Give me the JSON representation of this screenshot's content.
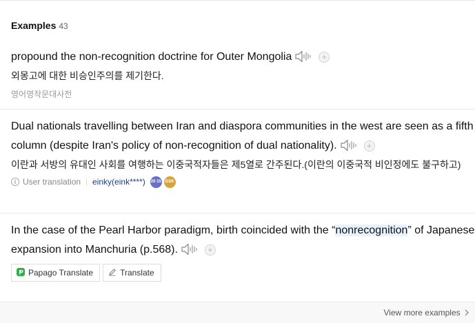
{
  "section": {
    "title": "Examples",
    "count": "43"
  },
  "examples": [
    {
      "english": "propound the non-recognition doctrine for Outer Mongolia",
      "korean": "외몽고에 대한 비승인주의를 제기한다.",
      "source": "영어영작문대사전"
    },
    {
      "english": "Dual nationals travelling between Iran and diaspora communities in the west are seen as a fifth column (despite Iran's policy of non-recognition of dual nationality).",
      "korean": "이란과 서방의 유대인 사회를 여행하는 이중국적자들은 제5열로 간주된다.(이란의 이중국적 비인정에도 불구하고)",
      "meta": {
        "user_translation": "User translation",
        "username": "einky(eink****)",
        "badge1": "20 15",
        "badge2": "DSK"
      }
    },
    {
      "english_before": "In the case of the Pearl Harbor paradigm, birth coincided with the “",
      "highlight": "nonrecognition",
      "english_after": "” of Japanese expansion into Manchuria (p.568)."
    }
  ],
  "buttons": {
    "papago": "Papago Translate",
    "translate": "Translate"
  },
  "footer": {
    "view_more": "View more examples"
  },
  "icons": {
    "speaker": "speaker-icon",
    "add": "plus-icon",
    "papago": "papago-icon",
    "translate": "pencil-icon",
    "info": "info-icon",
    "chevron": "chevron-right-icon"
  },
  "colors": {
    "highlight": "#e7f2fd",
    "user_link": "#1a3e8c",
    "papago_green": "#2bb34a",
    "papago_blue": "#2e7be4"
  }
}
